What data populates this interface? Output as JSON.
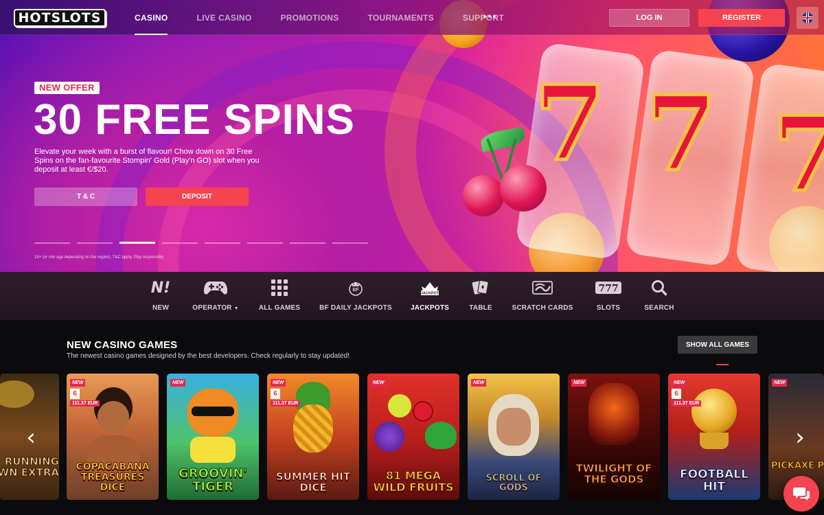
{
  "brand": {
    "logo_text": "HOTSLOTS"
  },
  "nav": {
    "items": [
      {
        "label": "CASINO",
        "active": true
      },
      {
        "label": "LIVE CASINO",
        "active": false
      },
      {
        "label": "PROMOTIONS",
        "active": false
      },
      {
        "label": "TOURNAMENTS",
        "active": false
      },
      {
        "label": "SUPPORT",
        "active": false
      }
    ],
    "more_icon": "more-dots-icon",
    "login_label": "LOG IN",
    "register_label": "REGISTER",
    "language_icon": "uk-flag-icon"
  },
  "hero": {
    "badge": "NEW OFFER",
    "title": "30 FREE SPINS",
    "description": "Elevate your week with a burst of flavour! Chow down on 30 Free Spins on the fan-favourite Stompin' Gold (Play'n GO) slot when you deposit at least €/$20.",
    "tc_label": "T & C",
    "deposit_label": "DEPOSIT",
    "slides_total": 8,
    "slide_active": 3,
    "disclaimer": "18+ (or min age depending on the region), T&C apply. Play responsibly"
  },
  "categories": [
    {
      "label": "NEW",
      "icon": "new-icon"
    },
    {
      "label": "OPERATOR",
      "icon": "gamepad-icon",
      "dropdown": true
    },
    {
      "label": "ALL GAMES",
      "icon": "grid-icon"
    },
    {
      "label": "BF DAILY JACKPOTS",
      "icon": "bf-jackpot-icon"
    },
    {
      "label": "JACKPOTS",
      "icon": "jackpot-crown-icon",
      "active": true
    },
    {
      "label": "TABLE",
      "icon": "cards-icon"
    },
    {
      "label": "SCRATCH CARDS",
      "icon": "scratch-card-icon"
    },
    {
      "label": "SLOTS",
      "icon": "777-icon"
    },
    {
      "label": "SEARCH",
      "icon": "search-icon"
    }
  ],
  "new_games": {
    "title": "NEW CASINO GAMES",
    "subtitle": "The newest casino games designed by the best developers. Check regularly to stay updated!",
    "show_all_label": "SHOW ALL GAMES",
    "partial_left": {
      "title": "RUNNING CROWN EXTRA"
    },
    "games": [
      {
        "title": "COPACABANA TREASURES DICE",
        "tag": "NEW",
        "jackpot_count": "6",
        "jackpot_amount": "111.37 EUR"
      },
      {
        "title": "GROOVIN' TIGER",
        "tag": "NEW"
      },
      {
        "title": "SUMMER HIT DICE",
        "tag": "NEW",
        "jackpot_count": "6",
        "jackpot_amount": "111.37 EUR"
      },
      {
        "title": "81 MEGA WILD FRUITS",
        "tag": "NEW"
      },
      {
        "title": "SCROLL OF GODS",
        "tag": "NEW"
      },
      {
        "title": "TWILIGHT OF THE GODS",
        "tag": "NEW"
      },
      {
        "title": "FOOTBALL HIT",
        "tag": "NEW",
        "jackpot_count": "6",
        "jackpot_amount": "111.37 EUR"
      }
    ],
    "partial_right": {
      "title": "PICKAXE POP",
      "tag": "NEW"
    },
    "prev_icon": "chevron-left-icon",
    "next_icon": "chevron-right-icon"
  },
  "chat_icon": "chat-bubble-icon",
  "colors": {
    "accent": "#f5434f",
    "badge_red": "#e42a50"
  }
}
